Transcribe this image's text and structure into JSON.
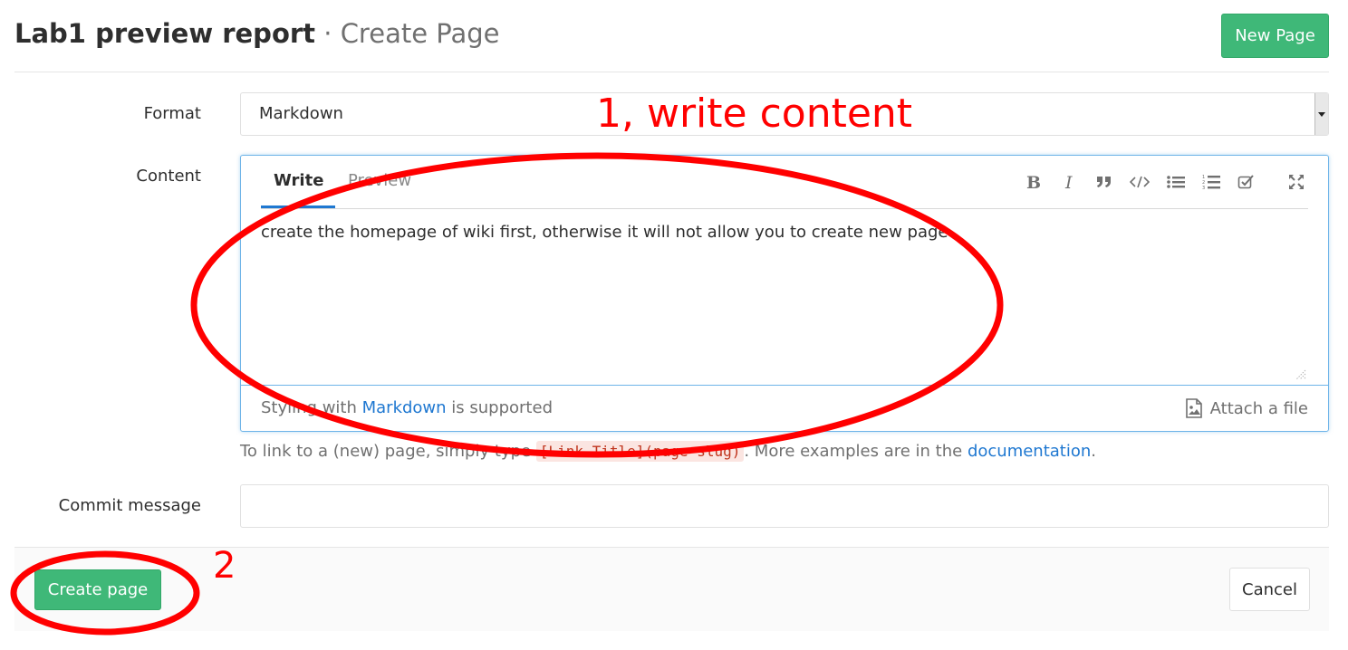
{
  "header": {
    "title": "Lab1 preview report",
    "separator": " · ",
    "subtitle": "Create Page",
    "new_page_label": "New Page"
  },
  "form": {
    "format_label": "Format",
    "format_value": "Markdown",
    "content_label": "Content",
    "commit_label": "Commit message",
    "commit_value": ""
  },
  "editor": {
    "tab_write": "Write",
    "tab_preview": "Preview",
    "toolbar_icons": [
      "bold-icon",
      "italic-icon",
      "quote-icon",
      "code-icon",
      "bullet-list-icon",
      "numbered-list-icon",
      "task-list-icon",
      "fullscreen-icon"
    ],
    "content": "create the homepage of wiki first, otherwise it will not allow you to create new page",
    "footer_prefix": "Styling with ",
    "footer_link": "Markdown",
    "footer_suffix": " is supported",
    "attach_label": "Attach a file"
  },
  "help": {
    "prefix": "To link to a (new) page, simply type ",
    "code": "[Link Title](page-slug)",
    "middle": ". More examples are in the ",
    "link": "documentation",
    "suffix": "."
  },
  "actions": {
    "create_label": "Create page",
    "cancel_label": "Cancel"
  },
  "annotations": {
    "step1": "1, write content",
    "step2": "2",
    "color": "#ff0000"
  },
  "colors": {
    "primary_green": "#3fb878",
    "link_blue": "#1f78d1",
    "focus_border": "#6eb4e8"
  }
}
